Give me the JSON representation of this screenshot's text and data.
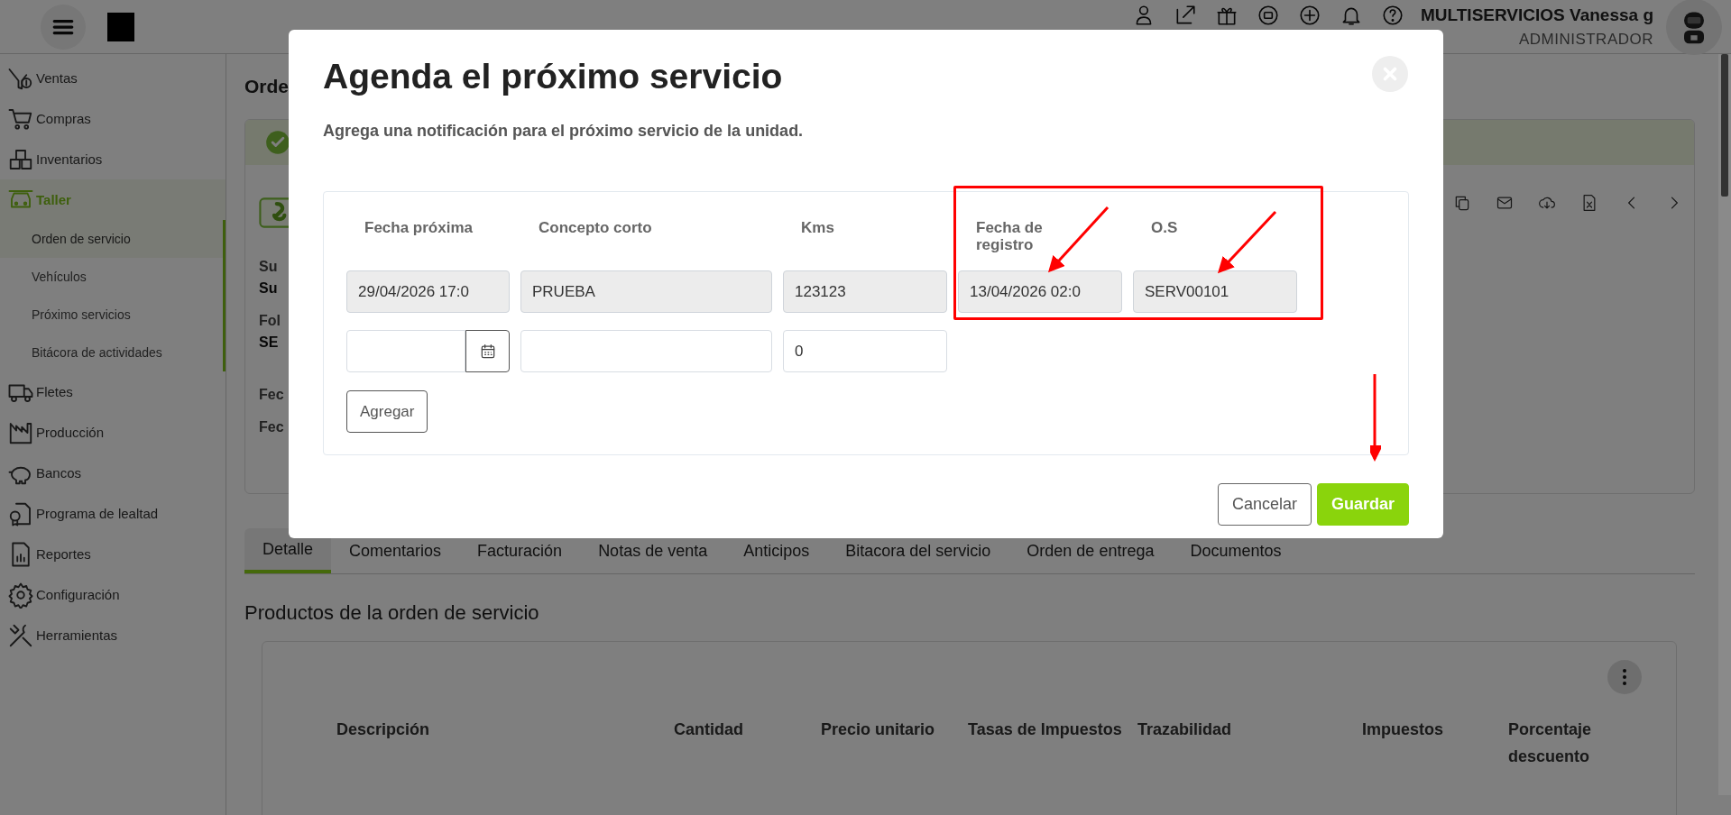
{
  "top_bar": {
    "user_name": "MULTISERVICIOS Vanessa g",
    "user_role": "ADMINISTRADOR"
  },
  "sidebar": {
    "items": [
      {
        "label": "Ventas",
        "selected": false
      },
      {
        "label": "Compras",
        "selected": false
      },
      {
        "label": "Inventarios",
        "selected": false
      },
      {
        "label": "Taller",
        "selected": true,
        "expanded": true,
        "children": [
          {
            "label": "Orden de servicio",
            "selected": true
          },
          {
            "label": "Vehículos",
            "selected": false
          },
          {
            "label": "Próximo servicios",
            "selected": false
          },
          {
            "label": "Bitácora de actividades",
            "selected": false
          }
        ]
      },
      {
        "label": "Fletes",
        "selected": false
      },
      {
        "label": "Producción",
        "selected": false
      },
      {
        "label": "Bancos",
        "selected": false
      },
      {
        "label": "Programa de lealtad",
        "selected": false
      },
      {
        "label": "Reportes",
        "selected": false
      },
      {
        "label": "Configuración",
        "selected": false
      },
      {
        "label": "Herramientas",
        "selected": false
      }
    ]
  },
  "page": {
    "title": "Orde",
    "summary": [
      {
        "text": "Su",
        "kind": "label"
      },
      {
        "text": "Su",
        "kind": "value"
      },
      {
        "text": "Fol",
        "kind": "label"
      },
      {
        "text": "SE",
        "kind": "value"
      },
      {
        "text": "Fec",
        "kind": "label"
      },
      {
        "text": "Fec",
        "kind": "label"
      }
    ]
  },
  "tabs": [
    {
      "label": "Detalle",
      "selected": true
    },
    {
      "label": "Comentarios",
      "selected": false
    },
    {
      "label": "Facturación",
      "selected": false
    },
    {
      "label": "Notas de venta",
      "selected": false
    },
    {
      "label": "Anticipos",
      "selected": false
    },
    {
      "label": "Bitacora del servicio",
      "selected": false
    },
    {
      "label": "Orden de entrega",
      "selected": false
    },
    {
      "label": "Documentos",
      "selected": false
    }
  ],
  "products": {
    "title": "Productos de la orden de servicio",
    "columns": [
      "Descripción",
      "Cantidad",
      "Precio unitario",
      "Tasas de Impuestos",
      "Trazabilidad",
      "Impuestos",
      "Porcentaje descuento"
    ]
  },
  "modal": {
    "title": "Agenda el próximo servicio",
    "subtitle": "Agrega una notificación para el próximo servicio de la unidad.",
    "columns": [
      "Fecha próxima",
      "Concepto corto",
      "Kms",
      "Fecha de registro",
      "O.S"
    ],
    "records": [
      {
        "readonly": true,
        "values": [
          "29/04/2026 17:0",
          "PRUEBA",
          "123123",
          "13/04/2026 02:0",
          "SERV00101"
        ]
      }
    ],
    "entry_row": [
      {
        "kind": "date"
      },
      {
        "kind": "text"
      },
      {
        "kind": "text",
        "value": "0"
      }
    ],
    "add_button": "Agregar",
    "buttons": [
      {
        "label": "Cancelar",
        "kind": "secondary"
      },
      {
        "label": "Guardar",
        "kind": "primary"
      }
    ]
  }
}
